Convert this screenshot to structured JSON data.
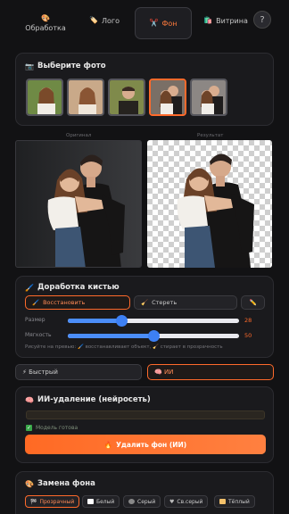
{
  "tabs": [
    {
      "icon": "🎨",
      "label": "Обработка"
    },
    {
      "icon": "🏷️",
      "label": "Лого"
    },
    {
      "icon": "✂️",
      "label": "Фон"
    },
    {
      "icon": "🛍️",
      "label": "Витрина"
    }
  ],
  "help_label": "?",
  "picker": {
    "title": "Выберите фото",
    "icon": "📷"
  },
  "compare": {
    "original": "Оригинал",
    "result": "Результат"
  },
  "brush": {
    "title": "Доработка кистью",
    "icon": "🖌️",
    "restore_label": "Восстановить",
    "erase_label": "Стереть",
    "size_label": "Размер",
    "size_value": "28",
    "size_fraction": 0.31,
    "softness_label": "Мягкость",
    "softness_value": "50",
    "softness_fraction": 0.5,
    "hint": "Рисуйте на превью: 🖌️ восстанавливает объект, 🧹 стирает в прозрачность"
  },
  "modes": {
    "fast": "⚡ Быстрый",
    "ai": "🧠 ИИ"
  },
  "ai": {
    "title": "ИИ-удаление (нейросеть)",
    "icon": "🧠",
    "status": "Модель готова",
    "button_label": "Удалить фон (ИИ)",
    "button_icon": "🔥"
  },
  "replace": {
    "title": "Замена фона",
    "icon": "🎨",
    "options": [
      "Прозрачный",
      "Белый",
      "Серый",
      "Св.серый",
      "Тёплый"
    ]
  },
  "colors": {
    "accent": "#ff6a2b",
    "slider": "#4b8df8",
    "background": "#121214"
  }
}
